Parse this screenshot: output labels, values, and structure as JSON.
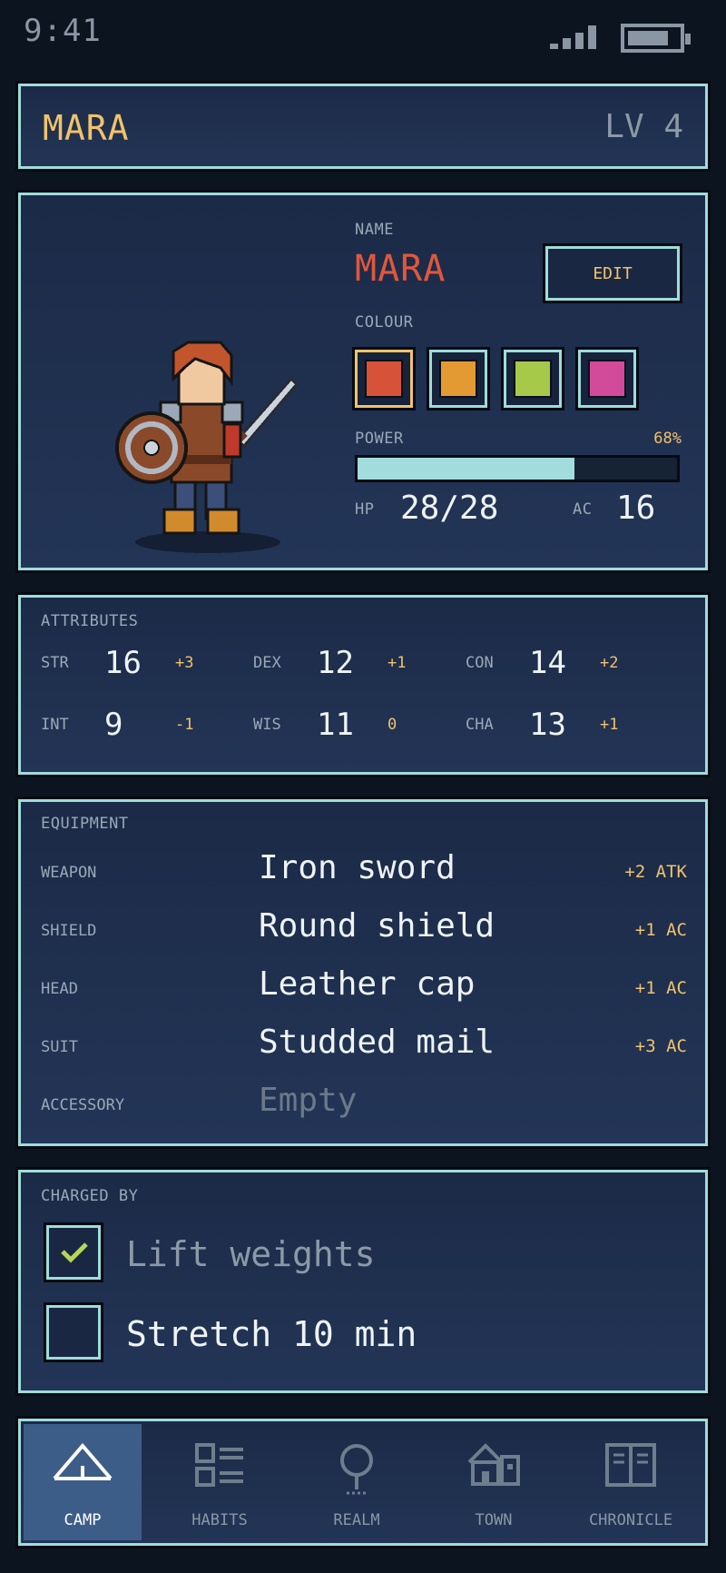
{
  "status_bar": {
    "time": "9:41"
  },
  "header": {
    "name": "MARA",
    "level": "LV 4"
  },
  "character": {
    "name_label": "NAME",
    "name": "MARA",
    "edit_label": "EDIT",
    "colour_label": "COLOUR",
    "colours": [
      "#d6533a",
      "#e39a32",
      "#a6c94a",
      "#d24b9a"
    ],
    "selected_colour_index": 0,
    "power_label": "POWER",
    "power_text": "68%",
    "power_fraction": 0.68,
    "hp_label": "HP",
    "hp": "28/28",
    "ac_label": "AC",
    "ac": "16"
  },
  "attributes": {
    "title": "ATTRIBUTES",
    "items": [
      {
        "key": "STR",
        "value": "16",
        "mod": "+3"
      },
      {
        "key": "DEX",
        "value": "12",
        "mod": "+1"
      },
      {
        "key": "CON",
        "value": "14",
        "mod": "+2"
      },
      {
        "key": "INT",
        "value": "9",
        "mod": "-1"
      },
      {
        "key": "WIS",
        "value": "11",
        "mod": "0"
      },
      {
        "key": "CHA",
        "value": "13",
        "mod": "+1"
      }
    ]
  },
  "equipment": {
    "title": "EQUIPMENT",
    "items": [
      {
        "slot": "WEAPON",
        "item": "Iron sword",
        "bonus": "+2 ATK"
      },
      {
        "slot": "SHIELD",
        "item": "Round shield",
        "bonus": "+1 AC"
      },
      {
        "slot": "HEAD",
        "item": "Leather cap",
        "bonus": "+1 AC"
      },
      {
        "slot": "SUIT",
        "item": "Studded mail",
        "bonus": "+3 AC"
      },
      {
        "slot": "ACCESSORY",
        "item": "Empty",
        "bonus": ""
      }
    ]
  },
  "charged_by": {
    "title": "CHARGED BY",
    "habits": [
      {
        "label": "Lift weights",
        "checked": true
      },
      {
        "label": "Stretch 10 min",
        "checked": false
      }
    ]
  },
  "nav": {
    "items": [
      {
        "label": "CAMP",
        "icon": "camp-icon",
        "active": true
      },
      {
        "label": "HABITS",
        "icon": "habits-icon",
        "active": false
      },
      {
        "label": "REALM",
        "icon": "realm-icon",
        "active": false
      },
      {
        "label": "TOWN",
        "icon": "town-icon",
        "active": false
      },
      {
        "label": "CHRONICLE",
        "icon": "chronicle-icon",
        "active": false
      }
    ]
  }
}
